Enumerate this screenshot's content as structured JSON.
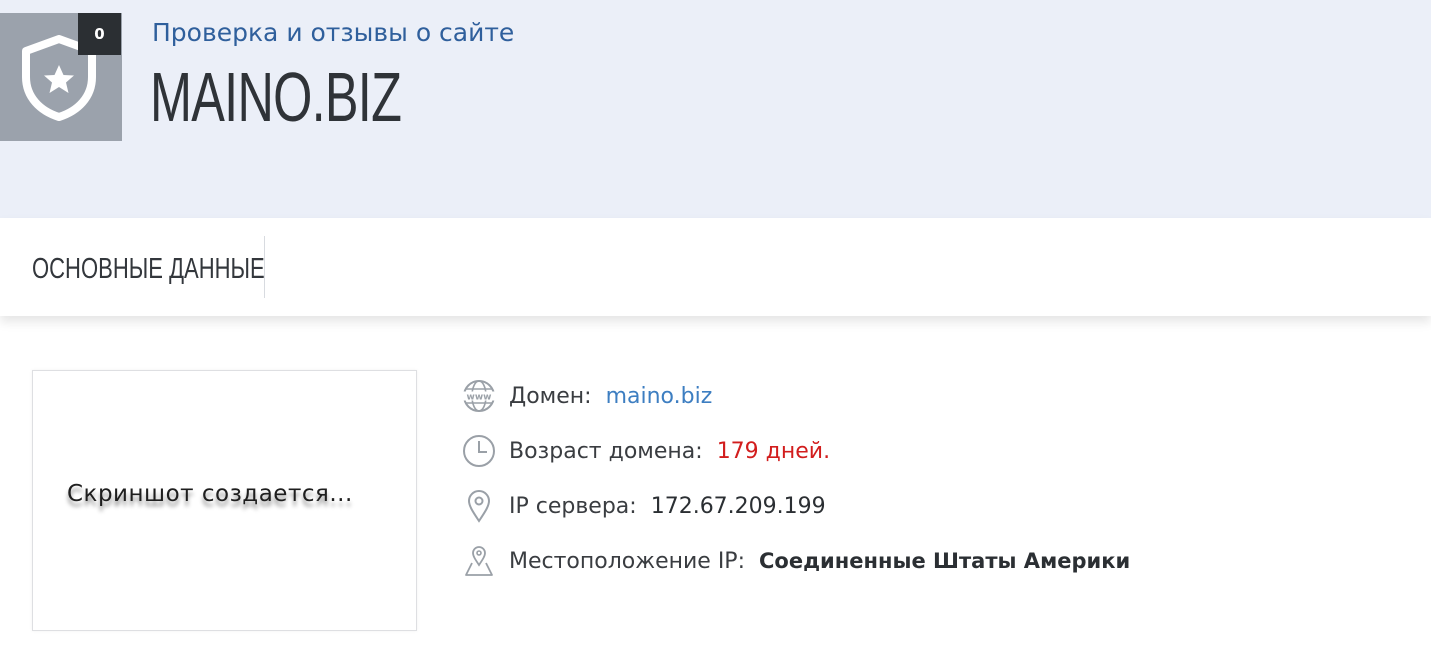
{
  "header": {
    "badge_count": "0",
    "subtitle": "Проверка и отзывы о сайте",
    "site_title": "MAINO.BIZ"
  },
  "tabs": [
    {
      "label": "ОСНОВНЫЕ ДАННЫЕ"
    }
  ],
  "screenshot": {
    "placeholder_text": "Скриншот создается..."
  },
  "info": {
    "domain": {
      "label": "Домен:",
      "value": "maino.biz",
      "icon": "www-globe-icon"
    },
    "age": {
      "label": "Возраст домена:",
      "value": "179 дней.",
      "icon": "clock-icon"
    },
    "ip": {
      "label": "IP сервера:",
      "value": "172.67.209.199",
      "icon": "location-pin-icon"
    },
    "location": {
      "label": "Местоположение IP:",
      "value": "Соединенные Штаты Америки",
      "icon": "map-pin-icon"
    }
  },
  "colors": {
    "header_bg": "#ebeff8",
    "subtitle": "#2f5f9c",
    "link": "#3d7ec1",
    "warning": "#d21d1d",
    "logo_bg": "#9ba2ac",
    "badge_bg": "#2b2f33"
  }
}
